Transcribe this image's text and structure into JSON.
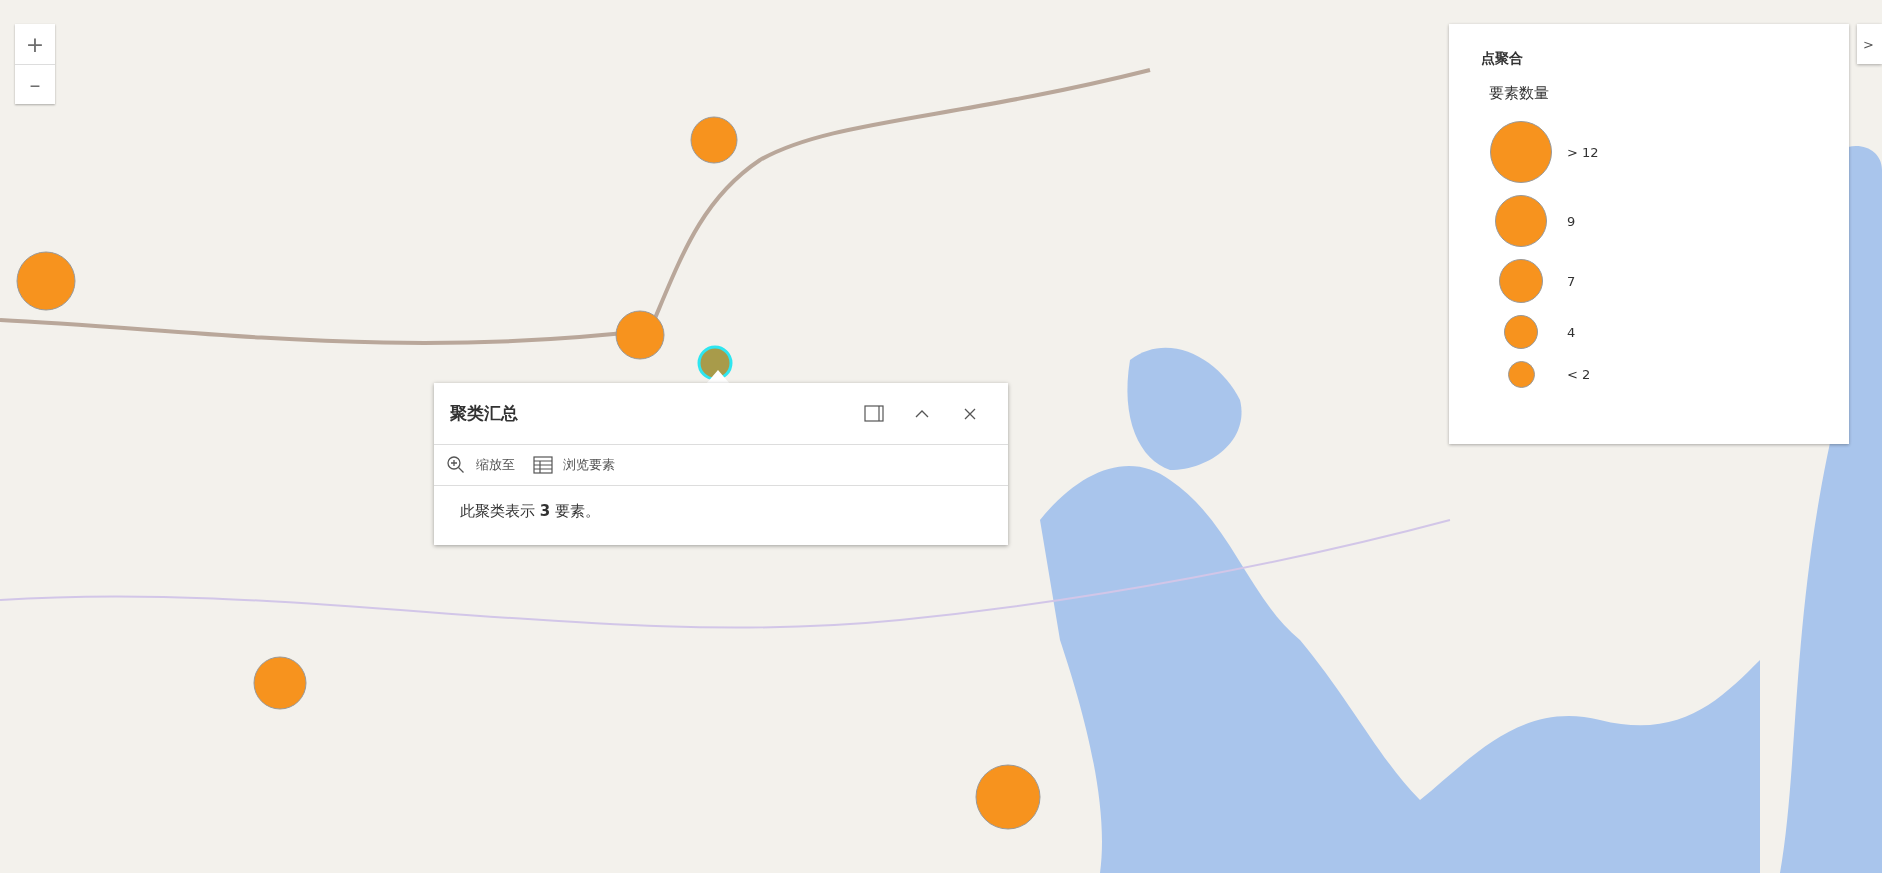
{
  "zoom_controls": [
    {
      "label": "+"
    },
    {
      "label": "–"
    }
  ],
  "legend": {
    "collapse_label": ">",
    "title": "点聚合",
    "field": "要素数量",
    "classes": [
      {
        "label": "> 12"
      },
      {
        "label": "9"
      },
      {
        "label": "7"
      },
      {
        "label": "4"
      },
      {
        "label": "< 2"
      }
    ]
  },
  "popup": {
    "title": "聚类汇总",
    "actions": [
      {
        "kind": "zoom",
        "label": "缩放至"
      },
      {
        "kind": "browse",
        "label": "浏览要素"
      }
    ],
    "content": "此聚类表示 **3** 要素。"
  }
}
